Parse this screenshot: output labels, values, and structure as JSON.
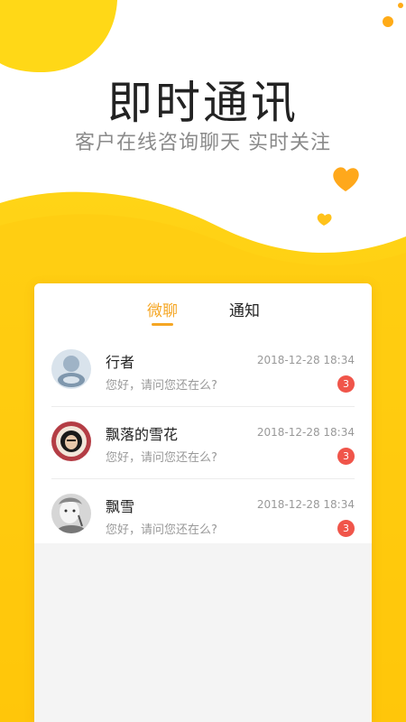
{
  "hero": {
    "title": "即时通讯",
    "subtitle": "客户在线咨询聊天  实时关注"
  },
  "tabs": [
    {
      "label": "微聊",
      "active": true
    },
    {
      "label": "通知",
      "active": false
    }
  ],
  "conversations": [
    {
      "name": "行者",
      "time": "2018-12-28 18:34",
      "message": "您好，请问您还在么?",
      "unread": "3"
    },
    {
      "name": "飘落的雪花",
      "time": "2018-12-28 18:34",
      "message": "您好，请问您还在么?",
      "unread": "3"
    },
    {
      "name": "飘雪",
      "time": "2018-12-28 18:34",
      "message": "您好，请问您还在么?",
      "unread": "3"
    }
  ],
  "colors": {
    "accent": "#f5a623",
    "brand_yellow": "#ffd21a",
    "badge": "#f0554a"
  }
}
